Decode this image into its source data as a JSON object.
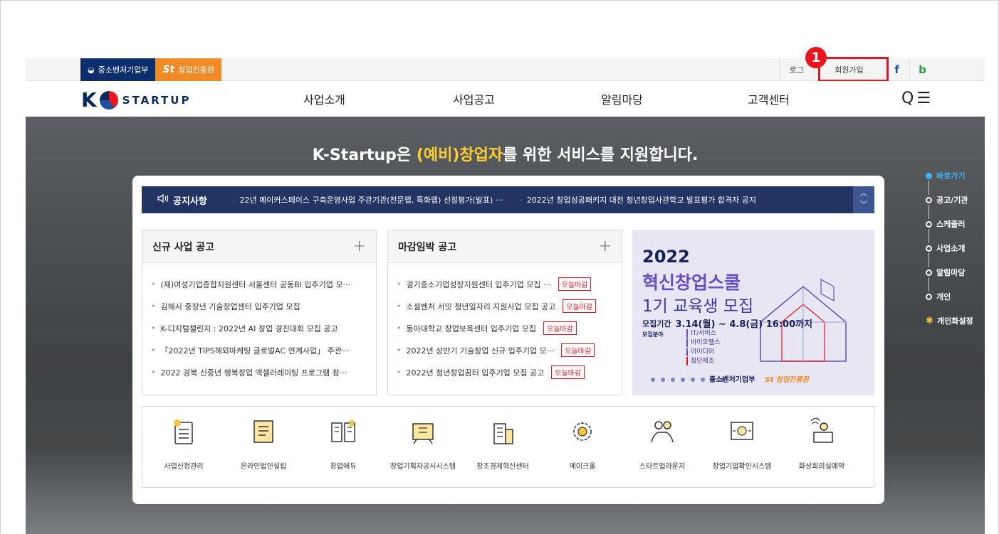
{
  "util": {
    "mss_label": "중소벤처기업부",
    "kised_mark": "St",
    "kised_label": "창업진흥원",
    "login_label": "로그",
    "join_label": "회원가입",
    "facebook_label": "f",
    "blog_label": "b",
    "badge_number": "1"
  },
  "gnb": {
    "logo_k": "K",
    "logo_text": "STARTUP",
    "menu": [
      "사업소개",
      "사업공고",
      "알림마당",
      "고객센터"
    ],
    "search_glyph": "Q",
    "menu_glyph": "☰"
  },
  "hero": {
    "title_pre": "K-Startup은 ",
    "title_hl": "(예비)창업자",
    "title_post": "를 위한 서비스를 지원합니다."
  },
  "notice": {
    "label": "공지사항",
    "items": [
      "22년 메이커스페이스 구축운영사업 주관기관(전문랩, 특화랩) 선정평가(발표) ···",
      "2022년 창업성공패키지 대전 청년창업사관학교 발표평가 합격자 공지"
    ],
    "up": "^",
    "down": "v"
  },
  "new_biz": {
    "title": "신규 사업 공고",
    "more": "+",
    "items": [
      "(재)여성기업종합지원센터 서울센터 공동BI 입주기업 모···",
      "김해시 중장년 기술창업센터 입주기업 모집",
      "K-디지털챌린지 : 2022년 AI 창업 경진대회 모집 공고",
      "「2022년 TIPS해외마케팅 글로벌AC 연계사업」 주관···",
      "2022 경북 신중년 행복창업 액셀러레이팅 프로그램 참···"
    ]
  },
  "deadline_biz": {
    "title": "마감임박 공고",
    "more": "+",
    "badge": "오늘마감",
    "items": [
      "경기중소기업성장지원센터 입주기업 모집 ···",
      "소셜벤처 서밋 청년일자리 지원사업 모집 공고",
      "동아대학교 창업보육센터 입주기업 모집",
      "2022년 상반기 기술창업 신규 입주기업 모···",
      "2022년 청년창업꿈터 입주기업 모집 공고"
    ]
  },
  "banner": {
    "year": "2022",
    "title1": "혁신창업스쿨",
    "title2": "1기 교육생 모집",
    "period_label": "모집기간",
    "period_value": "3.14(월) ~ 4.8(금) 16:00까지",
    "field_label": "모집분야",
    "fields": [
      "IT/서비스",
      "바이오헬스",
      "아이디어",
      "첨단제조"
    ],
    "logo1": "중소벤처기업부",
    "logo2": "St 창업진흥원"
  },
  "quick": [
    {
      "label": "사업신청관리",
      "icon": "checklist-icon"
    },
    {
      "label": "온라인법인설립",
      "icon": "document-icon"
    },
    {
      "label": "창업에듀",
      "icon": "book-icon"
    },
    {
      "label": "창업기획자공시시스템",
      "icon": "board-icon"
    },
    {
      "label": "창조경제혁신센터",
      "icon": "building-icon"
    },
    {
      "label": "메이크올",
      "icon": "gear-icon"
    },
    {
      "label": "스타트업라운지",
      "icon": "people-icon"
    },
    {
      "label": "창업기업확인시스템",
      "icon": "search-doc-icon"
    },
    {
      "label": "화상회의실예약",
      "icon": "video-meeting-icon"
    }
  ],
  "side": {
    "items": [
      "바로가기",
      "공고/기관",
      "스케줄러",
      "사업소개",
      "알림마당",
      "개인"
    ],
    "settings": "개인화설정"
  },
  "colors": {
    "navy": "#223463",
    "highlight": "#e8141e",
    "accent_yellow": "#ffcc32",
    "kised_orange": "#f08a27"
  }
}
